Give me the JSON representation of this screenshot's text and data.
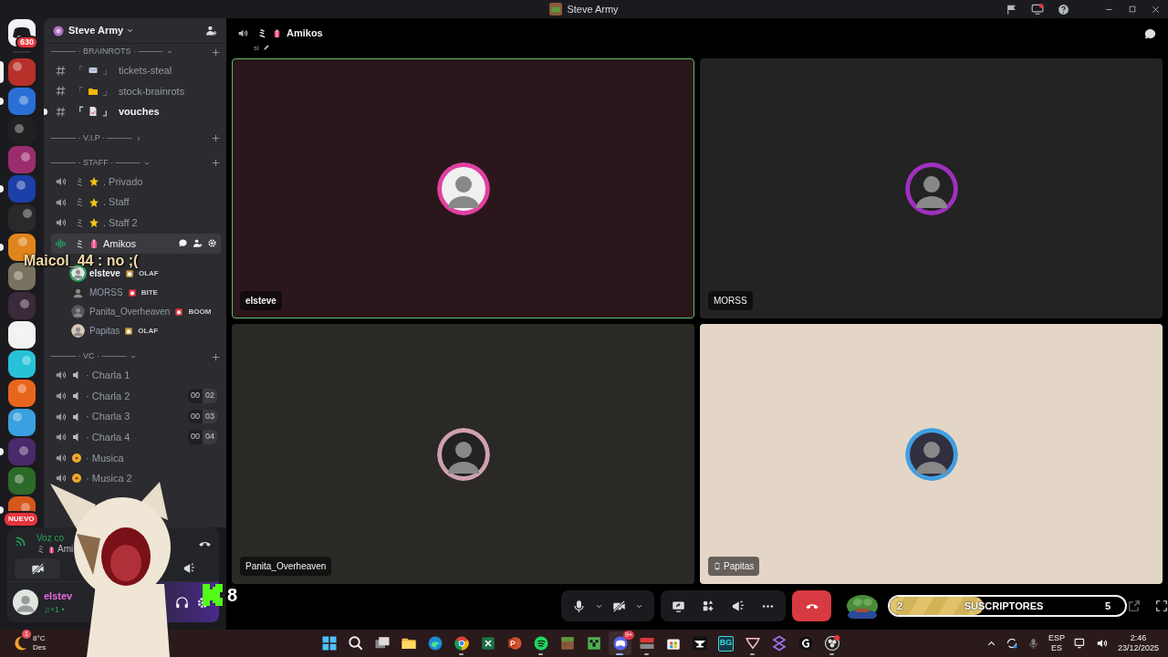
{
  "window": {
    "title": "Steve Army"
  },
  "server_rail": {
    "home_badge": "630",
    "servers": [
      {
        "color": "#b8302a",
        "selected": true,
        "unread": false
      },
      {
        "color": "#2a6fd6",
        "selected": false,
        "unread": true
      },
      {
        "color": "#202022",
        "selected": false,
        "unread": false
      },
      {
        "color": "#9b2d6f",
        "selected": false,
        "unread": false
      },
      {
        "color": "#1d3fa8",
        "selected": false,
        "unread": true
      },
      {
        "color": "#2a2a2a",
        "selected": false,
        "unread": false
      },
      {
        "color": "#e0851c",
        "selected": false,
        "unread": true
      },
      {
        "color": "#7a7260",
        "selected": false,
        "unread": false
      },
      {
        "color": "#3a2a3a",
        "selected": false,
        "unread": false
      },
      {
        "color": "#f2f2f2",
        "selected": false,
        "unread": false
      },
      {
        "color": "#27c2d8",
        "selected": false,
        "unread": false
      },
      {
        "color": "#e8661c",
        "selected": false,
        "unread": false
      },
      {
        "color": "#3aa0e0",
        "selected": false,
        "unread": false
      },
      {
        "color": "#4a2a6a",
        "selected": false,
        "unread": true
      },
      {
        "color": "#2d6a2a",
        "selected": false,
        "unread": false
      },
      {
        "color": "#d6561c",
        "selected": false,
        "unread": true,
        "badge": "NUEVO"
      }
    ]
  },
  "sidebar": {
    "server_name": "Steve Army",
    "channels": [
      {
        "kind": "category",
        "label": "——— · BRAINROTS · ———",
        "expanded": true
      },
      {
        "kind": "text",
        "prefix": "「",
        "suffix": "」",
        "name": "tickets-steal",
        "unread": false
      },
      {
        "kind": "text",
        "prefix": "「",
        "suffix": "」",
        "name": "stock-brainrots",
        "unread": false
      },
      {
        "kind": "text",
        "prefix": "「",
        "suffix": "」",
        "name": "vouches",
        "unread": true
      },
      {
        "kind": "category",
        "label": "——— · V.I.P · ———",
        "expanded": false
      },
      {
        "kind": "category",
        "label": "——— · STAFF · ———",
        "expanded": true
      },
      {
        "kind": "voice",
        "prefix": "ミ",
        "name": ". Privado",
        "selected": false
      },
      {
        "kind": "voice",
        "prefix": "ミ",
        "name": ". Staff",
        "selected": false
      },
      {
        "kind": "voice",
        "prefix": "ミ",
        "name": ". Staff 2",
        "selected": false
      },
      {
        "kind": "voice",
        "prefix": "ミ",
        "name": "Amikos",
        "selected": true,
        "members": [
          {
            "name": "elsteve",
            "speaking": true,
            "tag": "OLAF"
          },
          {
            "name": "MORSS",
            "speaking": false,
            "tag": "BITE"
          },
          {
            "name": "Panita_Overheaven",
            "speaking": false,
            "tag": "BOOM"
          },
          {
            "name": "Papitas",
            "speaking": false,
            "tag": "OLAF"
          }
        ]
      },
      {
        "kind": "category",
        "label": "——— · VC · ———",
        "expanded": true
      },
      {
        "kind": "voice",
        "name": "· Charla 1",
        "selected": false
      },
      {
        "kind": "voice",
        "name": "· Charla 2",
        "selected": false,
        "count": "00",
        "limit": "02"
      },
      {
        "kind": "voice",
        "name": "· Charla 3",
        "selected": false,
        "count": "00",
        "limit": "03"
      },
      {
        "kind": "voice",
        "name": "· Charla 4",
        "selected": false,
        "count": "00",
        "limit": "04"
      },
      {
        "kind": "voice",
        "name": "· Musica",
        "selected": false
      },
      {
        "kind": "voice",
        "name": "· Musica 2",
        "selected": false
      }
    ]
  },
  "voice_panel": {
    "status": "Voz co",
    "prefix": "ミ",
    "channel": "Ami"
  },
  "user_panel": {
    "name": "elstev",
    "activity": "♫+1 •"
  },
  "call": {
    "prefix": "ミ",
    "channel": "Amikos",
    "topic": "si",
    "tiles": [
      {
        "name": "elsteve",
        "speaking": true,
        "mobile": false,
        "color": "#2b171b"
      },
      {
        "name": "MORSS",
        "speaking": false,
        "mobile": false,
        "color": "#232323"
      },
      {
        "name": "Panita_Overheaven",
        "speaking": false,
        "mobile": false,
        "color": "#2a2926"
      },
      {
        "name": "Papitas",
        "speaking": false,
        "mobile": true,
        "color": "#e4d6c7"
      }
    ]
  },
  "overlay": {
    "chat": "Maicol_44 : no ;(",
    "kick_count": "8",
    "subs": {
      "current": "2",
      "label": "SUSCRIPTORES",
      "goal": "5",
      "level": 0.4
    }
  },
  "taskbar": {
    "weather_badge": "1",
    "temperature": "8°C",
    "weather_text": "Des",
    "apps": [
      {
        "kind": "start",
        "running": false,
        "active": false
      },
      {
        "kind": "search",
        "running": false,
        "active": false
      },
      {
        "kind": "taskview",
        "running": false,
        "active": false
      },
      {
        "kind": "folder",
        "running": false,
        "active": false
      },
      {
        "kind": "edge",
        "running": false,
        "active": false
      },
      {
        "kind": "chrome",
        "running": true,
        "active": false
      },
      {
        "kind": "excel",
        "running": false,
        "active": false
      },
      {
        "kind": "powerpoint",
        "running": false,
        "active": false
      },
      {
        "kind": "spotify",
        "running": true,
        "active": false
      },
      {
        "kind": "grass",
        "running": false,
        "active": false
      },
      {
        "kind": "creeper",
        "running": false,
        "active": false
      },
      {
        "kind": "discord",
        "running": true,
        "active": true,
        "badge": "9+"
      },
      {
        "kind": "mixer",
        "running": true,
        "active": false
      },
      {
        "kind": "store",
        "running": false,
        "active": false
      },
      {
        "kind": "anvil",
        "running": false,
        "active": false
      },
      {
        "kind": "label",
        "label": "BG",
        "running": false,
        "active": false
      },
      {
        "kind": "mlogo",
        "running": true,
        "active": false
      },
      {
        "kind": "slogo",
        "running": false,
        "active": false
      },
      {
        "kind": "glogo",
        "running": false,
        "active": false
      },
      {
        "kind": "obs",
        "running": true,
        "active": false
      }
    ],
    "language": "ESP",
    "layout": "ES",
    "time": "2:46",
    "date": "23/12/2025"
  }
}
